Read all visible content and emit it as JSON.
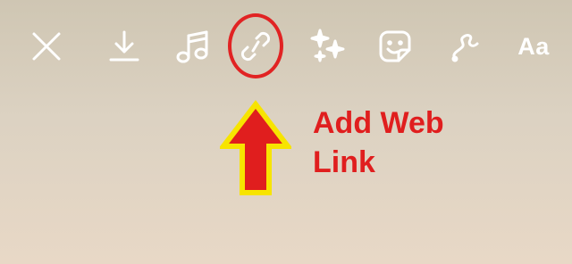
{
  "toolbar": {
    "items": [
      {
        "icon": "close-icon"
      },
      {
        "icon": "download-icon"
      },
      {
        "icon": "music-icon"
      },
      {
        "icon": "link-icon"
      },
      {
        "icon": "effects-sparkle-icon"
      },
      {
        "icon": "sticker-icon"
      },
      {
        "icon": "draw-icon"
      },
      {
        "label": "Aa"
      }
    ]
  },
  "annotation": {
    "line1": "Add Web",
    "line2": "Link",
    "text_color": "#e01e1e",
    "ring_color": "#e12323",
    "arrow_fill": "#e01e1e",
    "arrow_outline": "#f7e400"
  }
}
